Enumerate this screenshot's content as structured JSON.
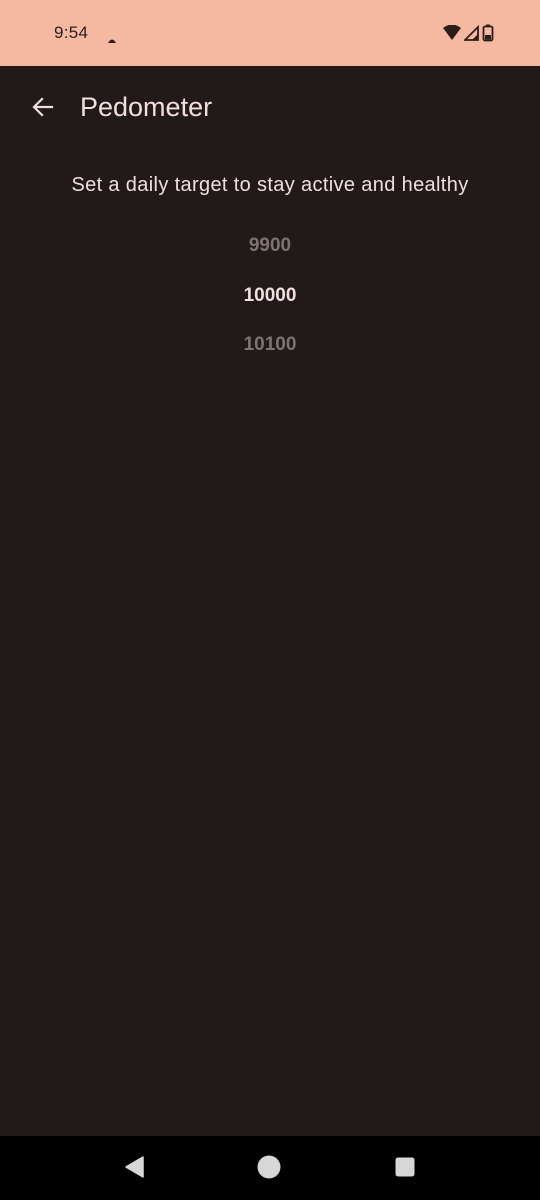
{
  "status_bar": {
    "time": "9:54",
    "icons": [
      "notification-icon",
      "wifi-icon",
      "cell-signal-icon",
      "battery-icon"
    ],
    "background": "#f4b9a0"
  },
  "app_bar": {
    "title": "Pedometer",
    "back_icon": "arrow-left-icon"
  },
  "main": {
    "subtitle": "Set a daily target to stay active and healthy",
    "picker": {
      "previous": "9900",
      "current": "10000",
      "next": "10100"
    }
  },
  "nav_bar": {
    "icons": [
      "back-triangle-icon",
      "home-circle-icon",
      "recents-square-icon"
    ]
  },
  "colors": {
    "background": "#221a19",
    "text": "#efe0dd",
    "text_dim": "#7d7371",
    "status_bar": "#f4b9a0"
  }
}
